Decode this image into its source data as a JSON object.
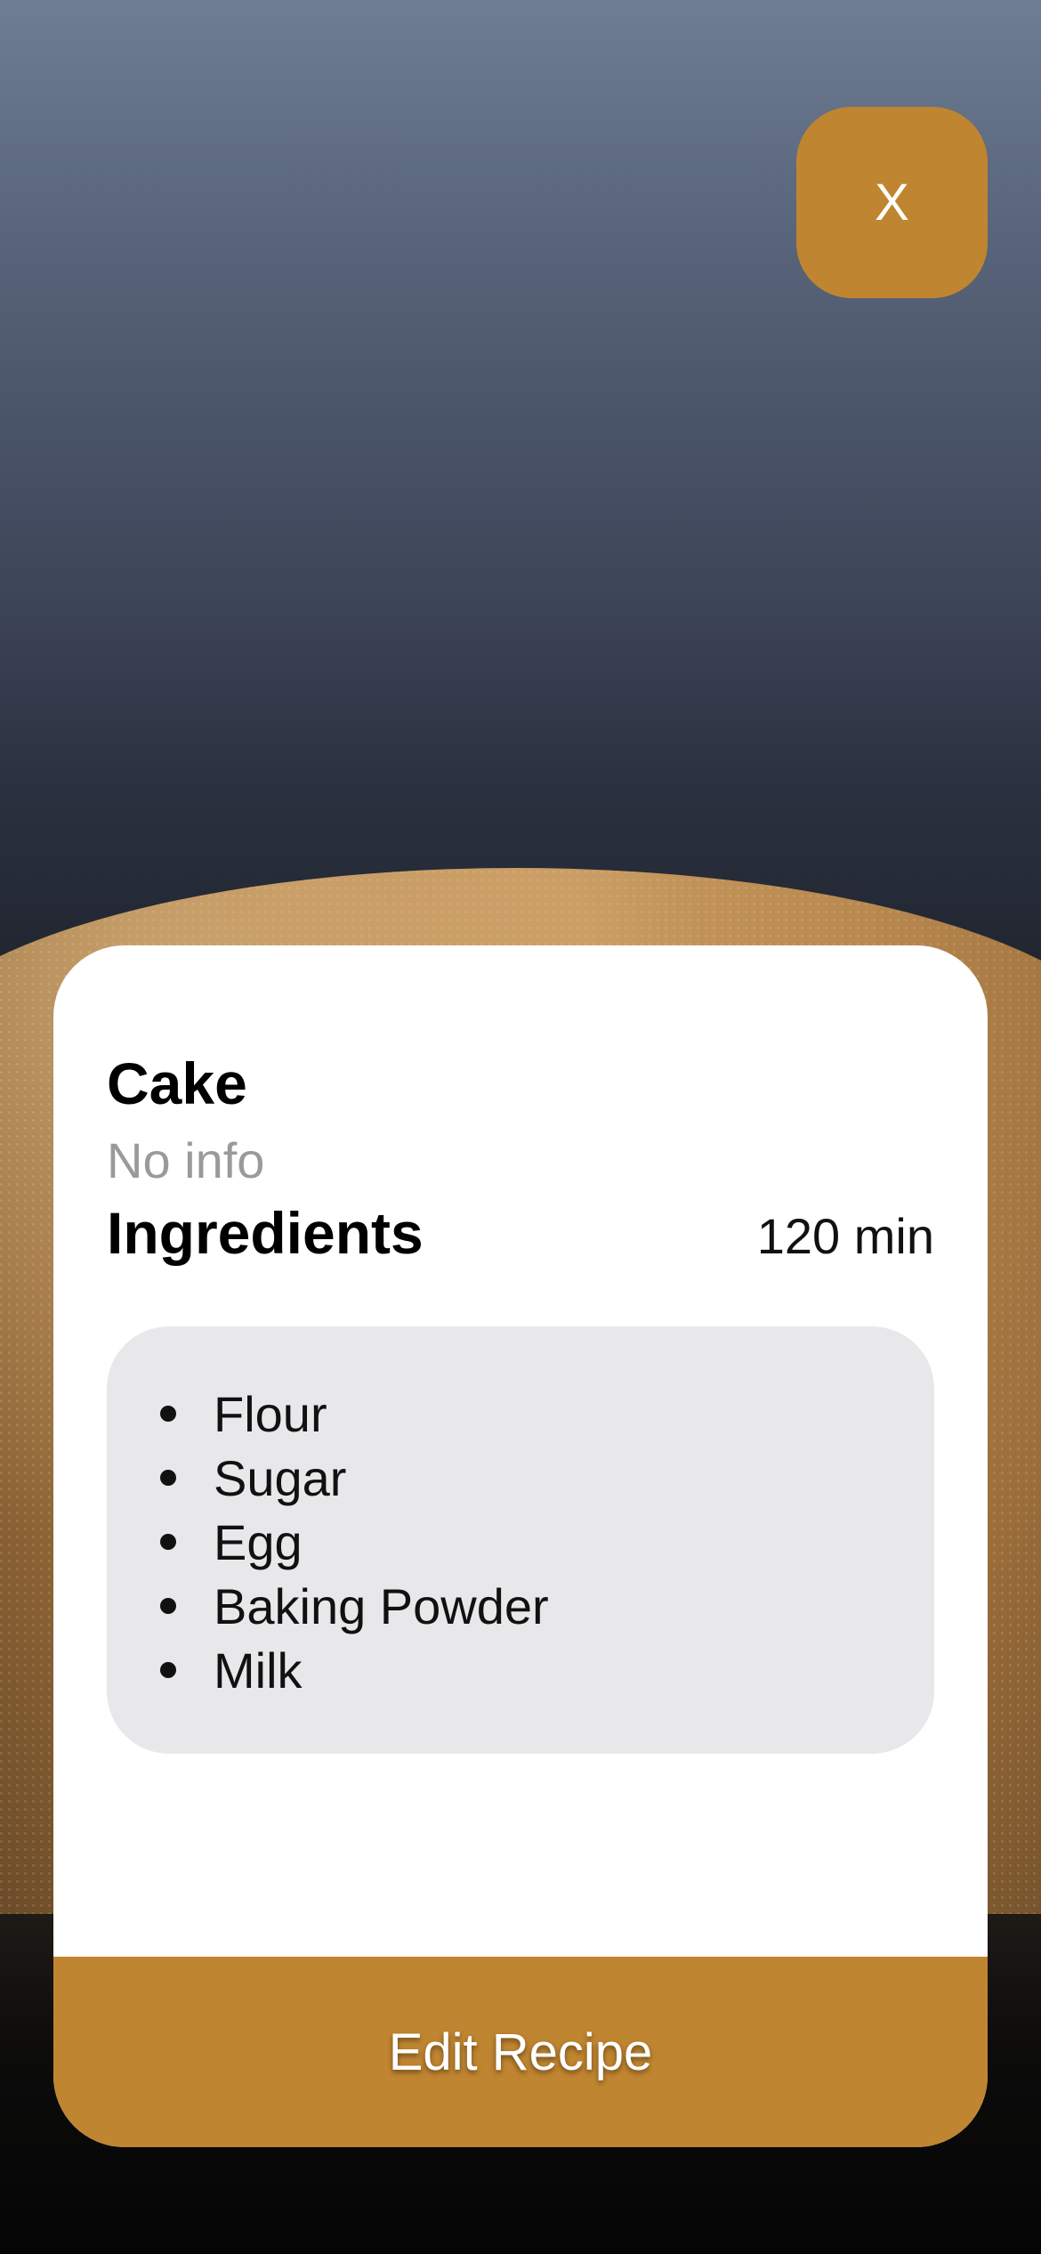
{
  "close_button": {
    "label": "X"
  },
  "recipe": {
    "title": "Cake",
    "description": "No info",
    "section_title": "Ingredients",
    "time": "120 min",
    "ingredients": [
      "Flour",
      "Sugar",
      "Egg",
      "Baking Powder",
      "Milk"
    ]
  },
  "edit_button": {
    "label": "Edit Recipe"
  },
  "colors": {
    "accent": "#c08530",
    "card": "#ffffff",
    "ingredients_bg": "#e8e8ea",
    "muted_text": "#9a9a9a"
  }
}
